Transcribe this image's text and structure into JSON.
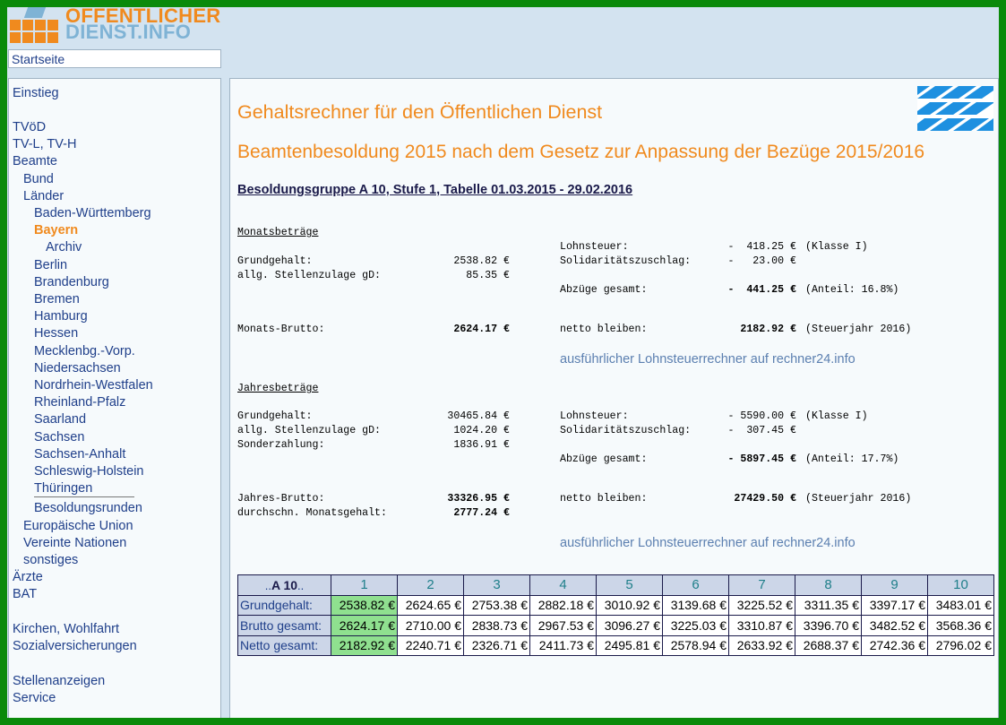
{
  "header": {
    "logo_line1": "OFFENTLICHER",
    "logo_line2": "DIENST.INFO",
    "home_link": "Startseite",
    "brand_colors": {
      "orange": "#f08a1e",
      "light_blue": "#7fb3d5"
    }
  },
  "sidebar": {
    "items": [
      {
        "label": "Einstieg",
        "level": 0
      },
      {
        "label": "TVöD",
        "level": 0
      },
      {
        "label": "TV-L, TV-H",
        "level": 0
      },
      {
        "label": "Beamte",
        "level": 0
      },
      {
        "label": "Bund",
        "level": 1
      },
      {
        "label": "Länder",
        "level": 1
      },
      {
        "label": "Baden-Württemberg",
        "level": 2
      },
      {
        "label": "Bayern",
        "level": 2,
        "active": true
      },
      {
        "label": "Archiv",
        "level": 3
      },
      {
        "label": "Berlin",
        "level": 2
      },
      {
        "label": "Brandenburg",
        "level": 2
      },
      {
        "label": "Bremen",
        "level": 2
      },
      {
        "label": "Hamburg",
        "level": 2
      },
      {
        "label": "Hessen",
        "level": 2
      },
      {
        "label": "Mecklenbg.-Vorp.",
        "level": 2
      },
      {
        "label": "Niedersachsen",
        "level": 2
      },
      {
        "label": "Nordrhein-Westfalen",
        "level": 2
      },
      {
        "label": "Rheinland-Pfalz",
        "level": 2
      },
      {
        "label": "Saarland",
        "level": 2
      },
      {
        "label": "Sachsen",
        "level": 2
      },
      {
        "label": "Sachsen-Anhalt",
        "level": 2
      },
      {
        "label": "Schleswig-Holstein",
        "level": 2
      },
      {
        "label": "Thüringen",
        "level": 2
      },
      {
        "label": "Besoldungsrunden",
        "level": 2
      },
      {
        "label": "Europäische Union",
        "level": 1
      },
      {
        "label": "Vereinte Nationen",
        "level": 1
      },
      {
        "label": "sonstiges",
        "level": 1
      },
      {
        "label": "Ärzte",
        "level": 0
      },
      {
        "label": "BAT",
        "level": 0
      },
      {
        "label": "Kirchen, Wohlfahrt",
        "level": 0
      },
      {
        "label": "Sozialversicherungen",
        "level": 0
      },
      {
        "label": "Stellenanzeigen",
        "level": 0
      },
      {
        "label": "Service",
        "level": 0
      }
    ]
  },
  "main": {
    "title": "Gehaltsrechner für den Öffentlichen Dienst",
    "subtitle": "Beamtenbesoldung 2015 nach dem Gesetz zur Anpassung der Bezüge 2015/2016",
    "group_title": "Besoldungsgruppe A 10, Stufe 1, Tabelle 01.03.2015 - 29.02.2016",
    "flag_colors": {
      "blue": "#1e90e0",
      "white": "#ffffff"
    },
    "monthly": {
      "section_title": "Monatsbeträge",
      "grundgehalt_label": "Grundgehalt:",
      "grundgehalt_value": "2538.82 €",
      "zulage_label": "allg. Stellenzulage gD:",
      "zulage_value": "85.35 €",
      "brutto_label": "Monats-Brutto:",
      "brutto_value": "2624.17 €",
      "lohnsteuer_label": "Lohnsteuer:",
      "lohnsteuer_value": "-  418.25 €",
      "lohnsteuer_note": "(Klasse I)",
      "soli_label": "Solidaritätszuschlag:",
      "soli_value": "-   23.00 €",
      "abzuege_label": "Abzüge gesamt:",
      "abzuege_value": "-  441.25 €",
      "abzuege_note": "(Anteil: 16.8%)",
      "netto_label": "netto bleiben:",
      "netto_value": "2182.92 €",
      "netto_note": "(Steuerjahr 2016)",
      "link": "ausführlicher Lohnsteuerrechner auf rechner24.info"
    },
    "yearly": {
      "section_title": "Jahresbeträge",
      "grundgehalt_label": "Grundgehalt:",
      "grundgehalt_value": "30465.84 €",
      "zulage_label": "allg. Stellenzulage gD:",
      "zulage_value": "1024.20 €",
      "sonder_label": "Sonderzahlung:",
      "sonder_value": "1836.91 €",
      "brutto_label": "Jahres-Brutto:",
      "brutto_value": "33326.95 €",
      "avg_label": "durchschn. Monatsgehalt:",
      "avg_value": "2777.24 €",
      "lohnsteuer_label": "Lohnsteuer:",
      "lohnsteuer_value": "- 5590.00 €",
      "lohnsteuer_note": "(Klasse I)",
      "soli_label": "Solidaritätszuschlag:",
      "soli_value": "-  307.45 €",
      "abzuege_label": "Abzüge gesamt:",
      "abzuege_value": "- 5897.45 €",
      "abzuege_note": "(Anteil: 17.7%)",
      "netto_label": "netto bleiben:",
      "netto_value": "27429.50 €",
      "netto_note": "(Steuerjahr 2016)",
      "link": "ausführlicher Lohnsteuerrechner auf rechner24.info"
    },
    "table": {
      "corner_prefix": "..",
      "corner_label": "A 10",
      "corner_suffix": "..",
      "stages": [
        "1",
        "2",
        "3",
        "4",
        "5",
        "6",
        "7",
        "8",
        "9",
        "10"
      ],
      "selected_stage_index": 0,
      "highlight_color": "#8fe08f",
      "rows": [
        {
          "label": "Grundgehalt:",
          "values": [
            "2538.82 €",
            "2624.65 €",
            "2753.38 €",
            "2882.18 €",
            "3010.92 €",
            "3139.68 €",
            "3225.52 €",
            "3311.35 €",
            "3397.17 €",
            "3483.01 €"
          ]
        },
        {
          "label": "Brutto gesamt:",
          "values": [
            "2624.17 €",
            "2710.00 €",
            "2838.73 €",
            "2967.53 €",
            "3096.27 €",
            "3225.03 €",
            "3310.87 €",
            "3396.70 €",
            "3482.52 €",
            "3568.36 €"
          ]
        },
        {
          "label": "Netto gesamt:",
          "values": [
            "2182.92 €",
            "2240.71 €",
            "2326.71 €",
            "2411.73 €",
            "2495.81 €",
            "2578.94 €",
            "2633.92 €",
            "2688.37 €",
            "2742.36 €",
            "2796.02 €"
          ]
        }
      ]
    }
  }
}
